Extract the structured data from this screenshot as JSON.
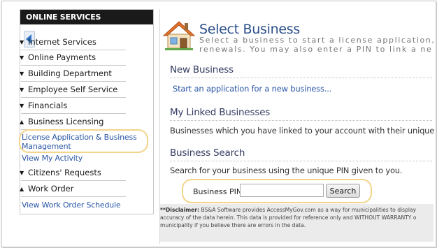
{
  "sidebar": {
    "header": "ONLINE SERVICES",
    "items": [
      {
        "label": "Internet Services",
        "state": "collapsed"
      },
      {
        "label": "Online Payments",
        "state": "collapsed"
      },
      {
        "label": "Building Department",
        "state": "collapsed"
      },
      {
        "label": "Employee Self Service",
        "state": "collapsed"
      },
      {
        "label": "Financials",
        "state": "collapsed"
      },
      {
        "label": "Business Licensing",
        "state": "expanded"
      },
      {
        "label": "Citizens' Requests",
        "state": "collapsed"
      },
      {
        "label": "Work Order",
        "state": "expanded"
      }
    ],
    "business_licensing_links": {
      "license_app_line1": "License Application & Business",
      "license_app_line2": "Management",
      "view_activity": "View My Activity"
    },
    "work_order_links": {
      "schedule": "View Work Order Schedule"
    }
  },
  "main": {
    "title": "Select Business",
    "subtitle_line1": "Select a business to start a license application,",
    "subtitle_line2": "renewals. You may also enter a PIN to link a ne",
    "new_business": {
      "heading": "New Business",
      "link": "Start an application for a new business..."
    },
    "linked": {
      "heading": "My Linked Businesses",
      "text": "Businesses which you have linked to your account with their unique PIN"
    },
    "search": {
      "heading": "Business Search",
      "text": "Search for your business using the unique PIN given to you.",
      "pin_label": "Business PIN:",
      "pin_value": "",
      "button": "Search"
    },
    "disclaimer": {
      "label": "**Disclaimer:",
      "line1": "BS&A Software provides AccessMyGov.com as a way for municipalities to display",
      "line2": "accuracy of the data herein. This data is provided for reference only and WITHOUT WARRANTY o",
      "line3": "municipality if you believe there are errors in the data."
    }
  },
  "colors": {
    "sidebar_header_bg": "#1a1a1a",
    "link": "#2b57a6",
    "title": "#2b4f8a",
    "highlight": "#f2d48a"
  },
  "icons": {
    "collapse": "triangle-left-icon",
    "logo": "house-icon",
    "collapsed_item": "triangle-down-icon",
    "expanded_item": "triangle-up-icon"
  }
}
